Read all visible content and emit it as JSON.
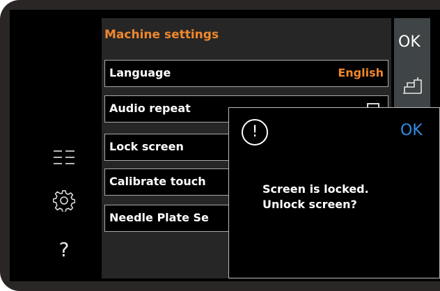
{
  "settings": {
    "title": "Machine settings",
    "rows": [
      {
        "label": "Language",
        "value": "English"
      },
      {
        "label": "Audio repeat",
        "value": ""
      },
      {
        "label": "Lock screen",
        "value": ""
      },
      {
        "label": "Calibrate touch",
        "value": ""
      },
      {
        "label": "Needle Plate Se",
        "value": ""
      }
    ]
  },
  "strip": {
    "ok_label": "OK"
  },
  "sidebar": {
    "help_glyph": "?"
  },
  "dialog": {
    "ok_label": "OK",
    "warn_glyph": "!",
    "message_line1": "Screen is locked.",
    "message_line2": "Unlock screen?"
  },
  "colors": {
    "accent_orange": "#f0872c",
    "ok_blue": "#2f8ee6",
    "bezel": "#2a2626"
  }
}
